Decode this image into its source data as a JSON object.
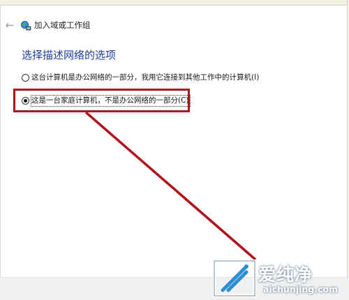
{
  "header": {
    "back_icon": "back-arrow-icon",
    "wizard_icon": "network-join-icon",
    "title": "加入域或工作组"
  },
  "page": {
    "heading": "选择描述网络的选项"
  },
  "options": [
    {
      "label": "这台计算机是办公网络的一部分，我用它连接到其他工作中的计算机(I)",
      "selected": false
    },
    {
      "label": "这是一台家庭计算机，不是办公网络的一部分(C)",
      "selected": true
    }
  ],
  "annotation": {
    "color": "#b0121b"
  },
  "watermark": {
    "logo_icon": "aichunjing-logo-icon",
    "text_cn": "爱纯净",
    "url": "aichunjing.com"
  }
}
